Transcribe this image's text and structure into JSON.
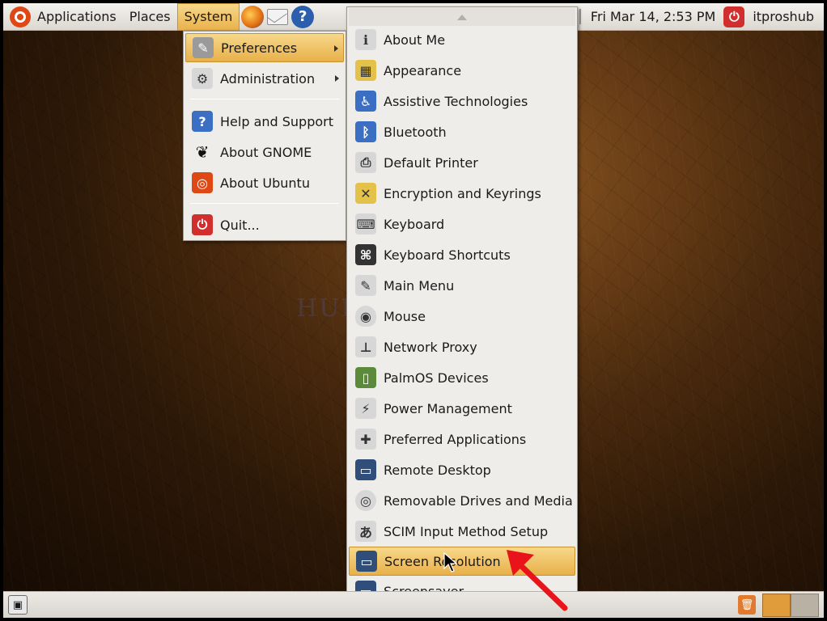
{
  "top_panel": {
    "menus": [
      "Applications",
      "Places",
      "System"
    ],
    "clock": "Fri Mar 14,  2:53 PM",
    "user": "itproshub"
  },
  "system_menu": {
    "items": [
      {
        "label": "Preferences",
        "icon": "preferences-icon",
        "submenu": true
      },
      {
        "label": "Administration",
        "icon": "administration-icon",
        "submenu": true
      },
      {
        "label": "Help and Support",
        "icon": "help-icon"
      },
      {
        "label": "About GNOME",
        "icon": "gnome-foot-icon"
      },
      {
        "label": "About Ubuntu",
        "icon": "ubuntu-logo-icon"
      },
      {
        "label": "Quit...",
        "icon": "power-icon"
      }
    ]
  },
  "preferences_menu": {
    "items": [
      {
        "label": "About Me",
        "icon": "about-me-icon"
      },
      {
        "label": "Appearance",
        "icon": "appearance-icon"
      },
      {
        "label": "Assistive Technologies",
        "icon": "accessibility-icon"
      },
      {
        "label": "Bluetooth",
        "icon": "bluetooth-icon"
      },
      {
        "label": "Default Printer",
        "icon": "printer-icon"
      },
      {
        "label": "Encryption and Keyrings",
        "icon": "keyrings-icon"
      },
      {
        "label": "Keyboard",
        "icon": "keyboard-icon"
      },
      {
        "label": "Keyboard Shortcuts",
        "icon": "keyboard-shortcuts-icon"
      },
      {
        "label": "Main Menu",
        "icon": "main-menu-icon"
      },
      {
        "label": "Mouse",
        "icon": "mouse-icon"
      },
      {
        "label": "Network Proxy",
        "icon": "network-proxy-icon"
      },
      {
        "label": "PalmOS Devices",
        "icon": "palm-device-icon"
      },
      {
        "label": "Power Management",
        "icon": "power-management-icon"
      },
      {
        "label": "Preferred Applications",
        "icon": "preferred-apps-icon"
      },
      {
        "label": "Remote Desktop",
        "icon": "remote-desktop-icon"
      },
      {
        "label": "Removable Drives and Media",
        "icon": "removable-drive-icon"
      },
      {
        "label": "SCIM Input Method Setup",
        "icon": "scim-icon"
      },
      {
        "label": "Screen Resolution",
        "icon": "screen-resolution-icon",
        "highlighted": true
      },
      {
        "label": "Screensaver",
        "icon": "screensaver-icon"
      }
    ]
  },
  "watermark": "HUE",
  "colors": {
    "highlight": "#e8b04a",
    "menu_bg": "#efedea",
    "annotation_arrow": "#e8141a"
  }
}
